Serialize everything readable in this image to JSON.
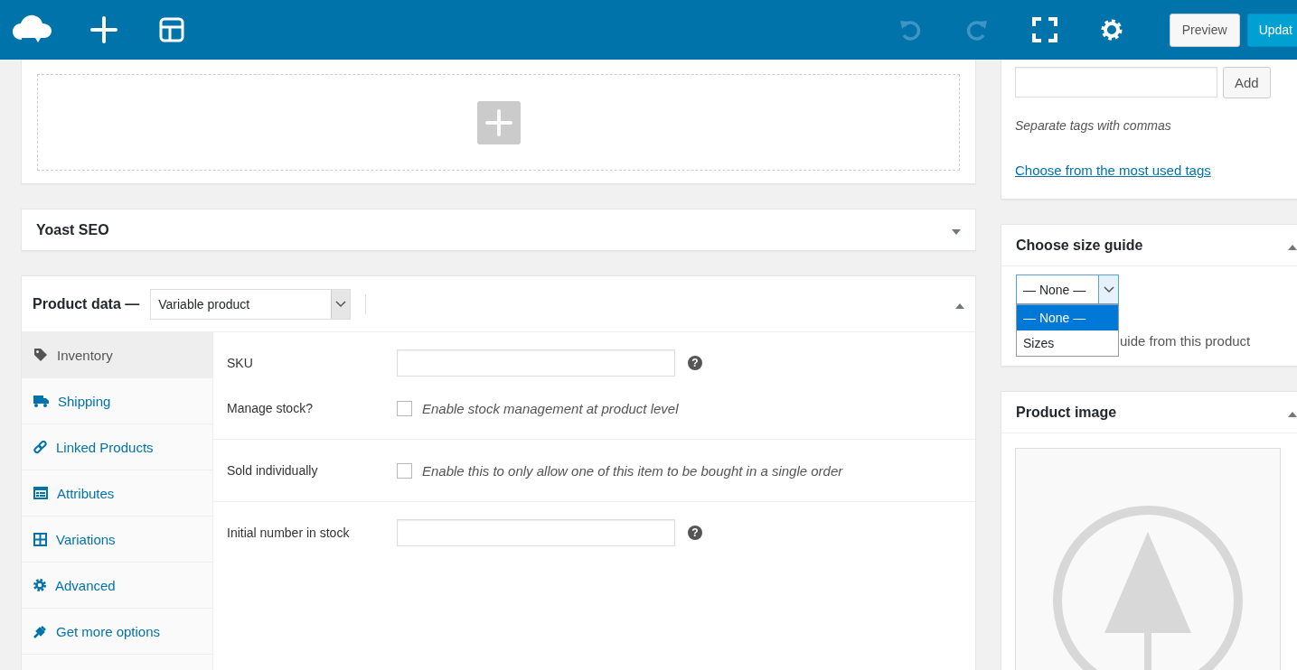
{
  "toolbar": {
    "left_icons": [
      {
        "kind": "logo"
      },
      {
        "kind": "add"
      },
      {
        "kind": "layout"
      }
    ],
    "history": [
      {
        "kind": "undo",
        "disabled": true
      },
      {
        "kind": "redo",
        "disabled": true
      }
    ],
    "tools": [
      {
        "kind": "fullscreen"
      },
      {
        "kind": "settings"
      }
    ],
    "buttons": [
      {
        "label": "Preview",
        "kind": "secondary"
      },
      {
        "label": "Updat",
        "kind": "primary"
      }
    ]
  },
  "yoast_box": {
    "title": "Yoast SEO",
    "expanded": false
  },
  "product_data": {
    "title": "Product data —",
    "expanded": true,
    "type_select": {
      "value": "Variable product"
    },
    "tabs": [
      {
        "label": "Inventory",
        "kind": "tag",
        "selected": true
      },
      {
        "label": "Shipping",
        "kind": "truck",
        "selected": false
      },
      {
        "label": "Linked Products",
        "kind": "link",
        "selected": false
      },
      {
        "label": "Attributes",
        "kind": "list",
        "selected": false
      },
      {
        "label": "Variations",
        "kind": "grid",
        "selected": false
      },
      {
        "label": "Advanced",
        "kind": "gear",
        "selected": false
      },
      {
        "label": "Get more options",
        "kind": "plug",
        "selected": false
      }
    ],
    "sections": [
      {
        "fields": [
          {
            "kind": "text",
            "label": "SKU",
            "help": "?"
          },
          {
            "kind": "checkbox",
            "label": "Manage stock?",
            "description": "Enable stock management at product level",
            "checked": false
          }
        ]
      },
      {
        "fields": [
          {
            "kind": "checkbox",
            "label": "Sold individually",
            "description": "Enable this to only allow one of this item to be bought in a single order",
            "checked": false
          }
        ]
      },
      {
        "fields": [
          {
            "kind": "text",
            "label": "Initial number in stock",
            "help": "?"
          }
        ]
      }
    ]
  },
  "tags_box": {
    "button": "Add",
    "hint": "Separate tags with commas",
    "link": "Choose from the most used tags"
  },
  "size_guide": {
    "title": "Choose size guide",
    "expanded": true,
    "select": {
      "value": "— None —",
      "open": true
    },
    "options": [
      {
        "label": "— None —",
        "selected": true
      },
      {
        "label": "Sizes",
        "selected": false
      }
    ],
    "hint": "uide from this product"
  },
  "product_image": {
    "title": "Product image",
    "expanded": true
  }
}
